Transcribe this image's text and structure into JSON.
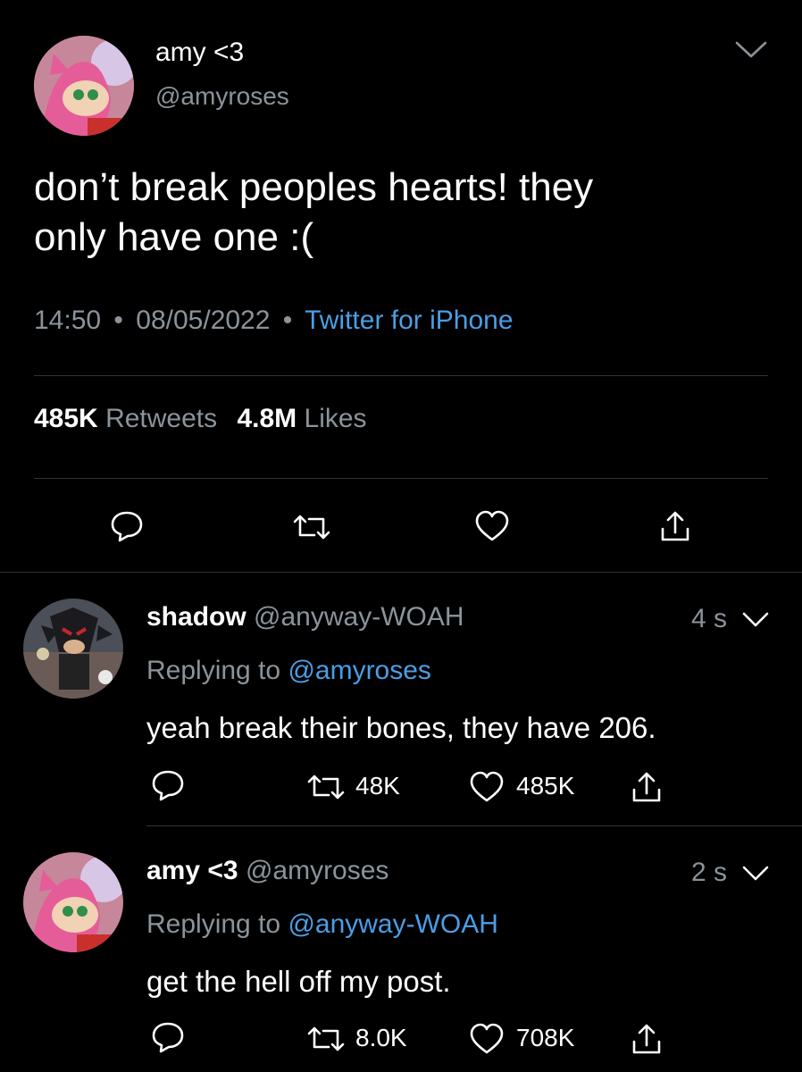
{
  "main_tweet": {
    "display_name": "amy <3",
    "handle": "@amyroses",
    "text_line1": "don’t break peoples hearts! they",
    "text_line2": "only have one :(",
    "time": "14:50",
    "date": "08/05/2022",
    "source": "Twitter for iPhone",
    "retweets_count": "485K",
    "retweets_label": "Retweets",
    "likes_count": "4.8M",
    "likes_label": "Likes",
    "separator": "•"
  },
  "replies": [
    {
      "display_name": "shadow",
      "handle": "@anyway-WOAH",
      "age": "4 s",
      "replying_prefix": "Replying to",
      "replying_to": "@amyroses",
      "text": "yeah break their bones, they have 206.",
      "retweets": "48K",
      "likes": "485K"
    },
    {
      "display_name": "amy <3",
      "handle": "@amyroses",
      "age": "2 s",
      "replying_prefix": "Replying to",
      "replying_to": "@anyway-WOAH",
      "text": "get the hell off my post.",
      "retweets": "8.0K",
      "likes": "708K"
    }
  ],
  "icons": [
    "chevron-down-icon",
    "reply-icon",
    "retweet-icon",
    "like-icon",
    "share-icon"
  ],
  "colors": {
    "background": "#000000",
    "text": "#ffffff",
    "muted": "#8b939b",
    "link": "#4a9ee6",
    "divider": "#2f3336"
  }
}
